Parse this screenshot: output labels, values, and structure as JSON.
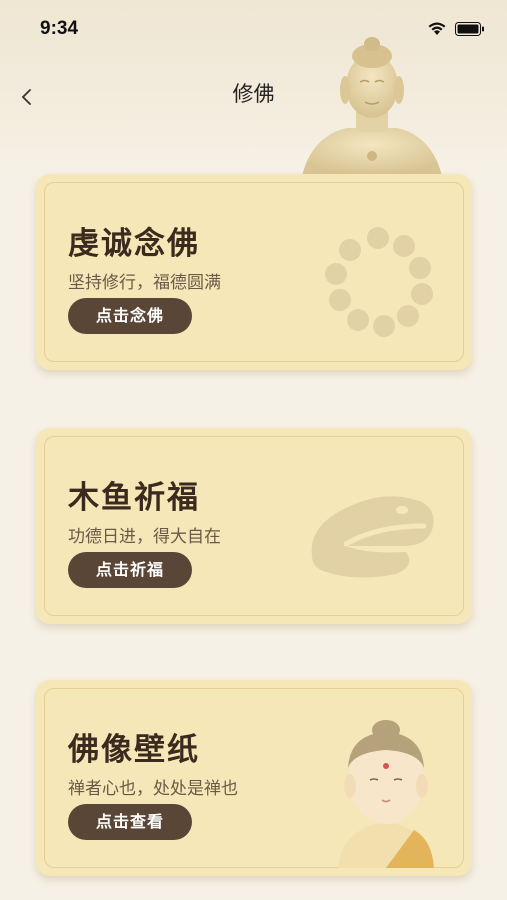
{
  "status_bar": {
    "time": "9:34"
  },
  "nav": {
    "title": "修佛"
  },
  "cards": [
    {
      "title": "虔诚念佛",
      "subtitle": "坚持修行，福德圆满",
      "button": "点击念佛",
      "illustration": "prayer-beads-icon"
    },
    {
      "title": "木鱼祈福",
      "subtitle": "功德日进，得大自在",
      "button": "点击祈福",
      "illustration": "wooden-fish-icon"
    },
    {
      "title": "佛像壁纸",
      "subtitle": "禅者心也，处处是禅也",
      "button": "点击查看",
      "illustration": "monk-icon"
    }
  ],
  "colors": {
    "background": "#f6f1e6",
    "card": "#f6e7b8",
    "button": "#5a4636",
    "ornament": "#e2d1a4"
  }
}
